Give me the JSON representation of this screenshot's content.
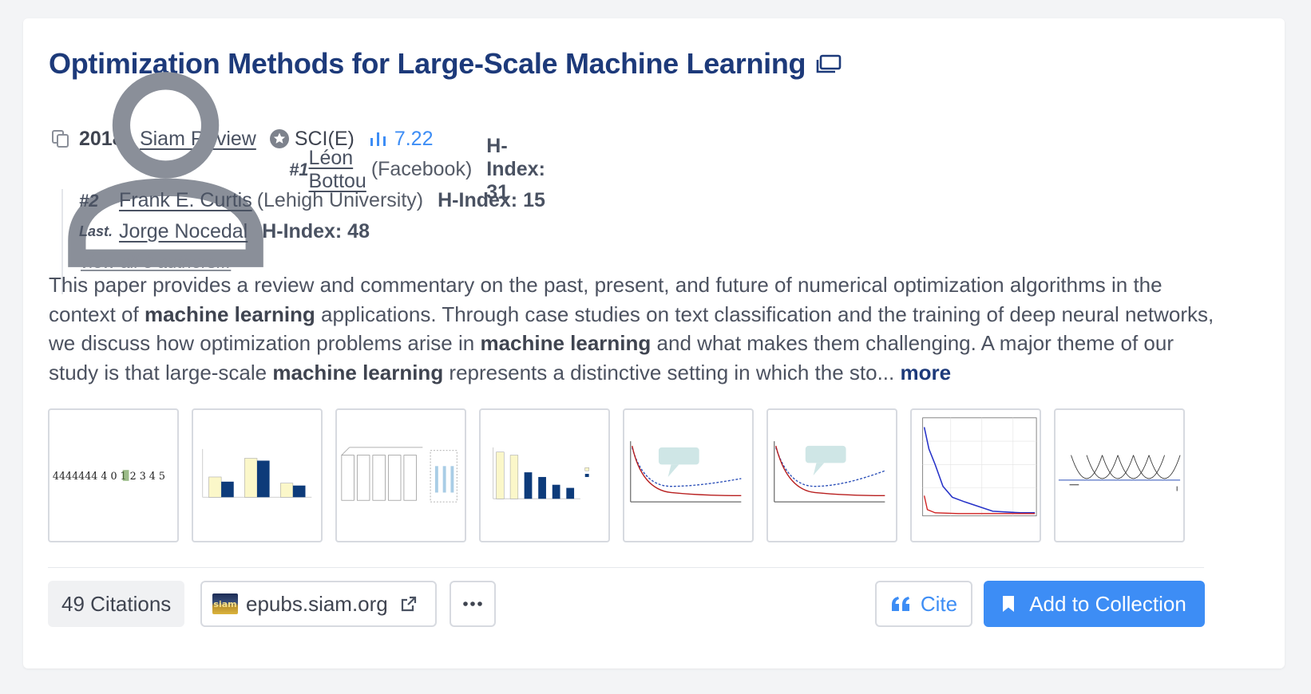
{
  "paper": {
    "title": "Optimization Methods for Large-Scale Machine Learning",
    "year": "2018",
    "venue": "Siam Review",
    "index_badge": "SCI(E)",
    "impact_factor": "7.22"
  },
  "authors": [
    {
      "rank": "#1",
      "name": "Léon Bottou",
      "affiliation": "(Facebook)",
      "hindex": "H-Index: 31"
    },
    {
      "rank": "#2",
      "name": "Frank E. Curtis",
      "affiliation": "(Lehigh University)",
      "hindex": "H-Index: 15"
    },
    {
      "rank": "Last.",
      "name": "Jorge Nocedal",
      "affiliation": "",
      "hindex": "H-Index: 48"
    }
  ],
  "view_all_authors": "view all 3 authors...",
  "abstract": {
    "p1": "This paper provides a review and commentary on the past, present, and future of numerical optimization algorithms in the context of ",
    "h1": "machine learning",
    "p2": " applications. Through case studies on text classification and the training of deep neural networks, we discuss how optimization problems arise in ",
    "h2": "machine learning",
    "p3": " and what makes them challenging. A major theme of our study is that large-scale ",
    "h3": "machine learning",
    "p4": " represents a distinctive setting in which the sto... ",
    "more": "more"
  },
  "figures": [
    {
      "kind": "digits",
      "text": "4444444 4 0 1 2 3 4 5"
    },
    {
      "kind": "bar-chart"
    },
    {
      "kind": "cnn-diagram"
    },
    {
      "kind": "bar-chart-2"
    },
    {
      "kind": "curve-plot"
    },
    {
      "kind": "curve-plot-2"
    },
    {
      "kind": "convergence-plot"
    },
    {
      "kind": "parabolas"
    }
  ],
  "footer": {
    "citations": "49 Citations",
    "source_site": "epubs.siam.org",
    "siam_logo_text": "siam",
    "cite_label": "Cite",
    "add_label": "Add to Collection"
  },
  "colors": {
    "title": "#1d3a7a",
    "accent": "#3d8df5"
  }
}
